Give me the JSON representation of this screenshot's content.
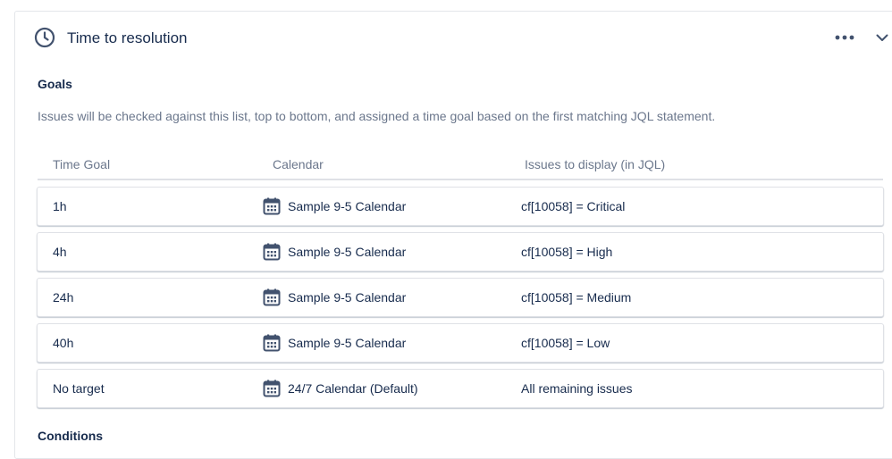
{
  "panel": {
    "title": "Time to resolution",
    "icon": "clock-icon"
  },
  "goals": {
    "section_title": "Goals",
    "description": "Issues will be checked against this list, top to bottom, and assigned a time goal based on the first matching JQL statement.",
    "columns": [
      "Time Goal",
      "Calendar",
      "Issues to display (in JQL)"
    ],
    "rows": [
      {
        "goal": "1h",
        "calendar": "Sample 9-5 Calendar",
        "jql": "cf[10058] = Critical"
      },
      {
        "goal": "4h",
        "calendar": "Sample 9-5 Calendar",
        "jql": "cf[10058] = High"
      },
      {
        "goal": "24h",
        "calendar": "Sample 9-5 Calendar",
        "jql": "cf[10058] = Medium"
      },
      {
        "goal": "40h",
        "calendar": "Sample 9-5 Calendar",
        "jql": "cf[10058] = Low"
      },
      {
        "goal": "No target",
        "calendar": "24/7 Calendar (Default)",
        "jql": "All remaining issues"
      }
    ]
  },
  "next_section_title": "Conditions",
  "colors": {
    "text": "#172b4d",
    "muted": "#6b778c",
    "border": "#dfe1e6"
  }
}
